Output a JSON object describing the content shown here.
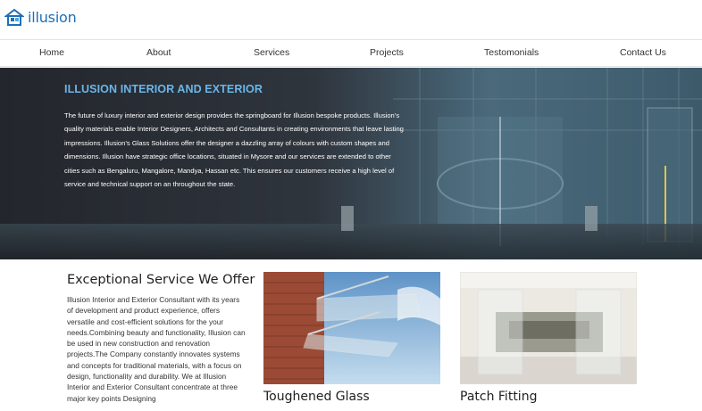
{
  "logo": {
    "text": "illusion",
    "brand_color": "#1e6fb8"
  },
  "nav": {
    "items": [
      "Home",
      "About",
      "Services",
      "Projects",
      "Testomonials",
      "Contact Us"
    ]
  },
  "hero": {
    "title": "ILLUSION INTERIOR AND EXTERIOR",
    "title_color": "#6bb6e8",
    "text": "The future of luxury interior and exterior design provides the springboard for Illusion bespoke products. Illusion’s quality materials enable Interior Designers, Architects and Consultants in creating environments that leave lasting impressions. Illusion’s Glass Solutions offer the designer a dazzling array of colours with custom shapes and dimensions. Illusion have strategic office locations, situated in Mysore and our services are extended to other cities such as Bengaluru, Mangalore, Mandya, Hassan etc. This ensures our customers receive a high level of service and technical support on an throughout the state."
  },
  "services": {
    "title": "Exceptional Service We Offer",
    "text": "Illusion Interior and Exterior Consultant with its years of development and product experience, offers versatile and cost-efficient solutions for the your needs.Combining beauty and functionality, Illusion can be used in new construction and renovation projects.The Company constantly innovates systems and concepts for traditional materials, with a focus on design, functionality and durability. We at Illusion Interior and Exterior Consultant concentrate at three major key points Designing"
  },
  "cards": [
    {
      "title": "Toughened Glass",
      "image": "glass-canopy-photo"
    },
    {
      "title": "Patch Fitting",
      "image": "glass-partition-photo"
    }
  ]
}
